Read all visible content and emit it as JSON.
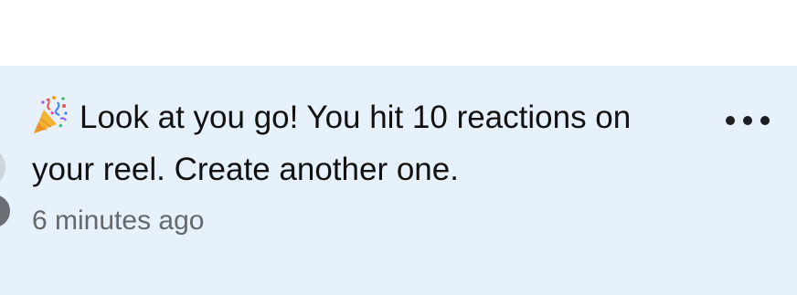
{
  "notification": {
    "icon": "party-popper-icon",
    "message": "Look at you go! You hit 10 reactions on your reel. Create another one.",
    "timestamp": "6 minutes ago",
    "more_icon": "more-horizontal-icon"
  },
  "colors": {
    "unread_background": "#e7f1fc",
    "text_primary": "#111111",
    "text_secondary": "#65686c"
  }
}
